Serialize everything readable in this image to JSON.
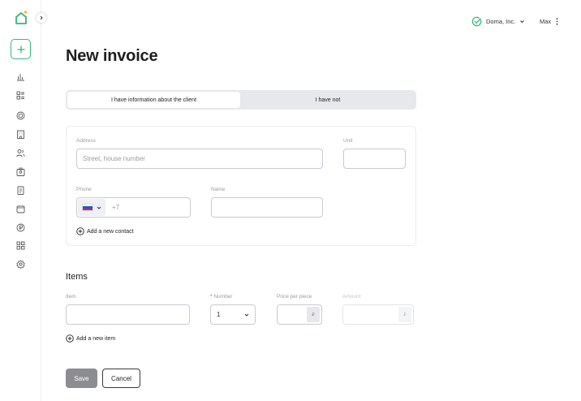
{
  "colors": {
    "accent": "#3bb57a",
    "logo_dot": "#f4b21a",
    "required": "#e5484d"
  },
  "sidebar": {
    "logo": "home-logo",
    "collapse_icon": "chevron-right-icon",
    "add_icon": "plus-icon",
    "items": [
      {
        "icon": "bar-chart-icon"
      },
      {
        "icon": "list-grid-icon"
      },
      {
        "icon": "target-icon"
      },
      {
        "icon": "building-icon"
      },
      {
        "icon": "users-icon"
      },
      {
        "icon": "badge-icon"
      },
      {
        "icon": "document-icon"
      },
      {
        "icon": "wallet-icon"
      },
      {
        "icon": "currency-icon"
      },
      {
        "icon": "apps-icon"
      },
      {
        "icon": "settings-icon"
      }
    ]
  },
  "topbar": {
    "company": "Doma, Inc.",
    "user": "Max"
  },
  "page": {
    "title": "New invoice"
  },
  "client_toggle": {
    "option_active": "I have information about the client",
    "option_inactive": "I have not"
  },
  "client_form": {
    "address_label": "Address",
    "address_placeholder": "Street, house number",
    "unit_label": "Unit",
    "unit_value": "",
    "phone_label": "Phone",
    "phone_prefix": "+7",
    "name_label": "Name",
    "name_value": "",
    "add_contact": "Add a new contact"
  },
  "items": {
    "section_title": "Items",
    "item_label": "Item",
    "item_value": "",
    "number_required_mark": "*",
    "number_label": "Number",
    "number_value": "1",
    "price_label": "Price per piece",
    "price_value": "",
    "currency": "₽",
    "amount_label": "Amount",
    "amount_value": "",
    "add_item": "Add a new item"
  },
  "actions": {
    "save": "Save",
    "cancel": "Cancel"
  }
}
